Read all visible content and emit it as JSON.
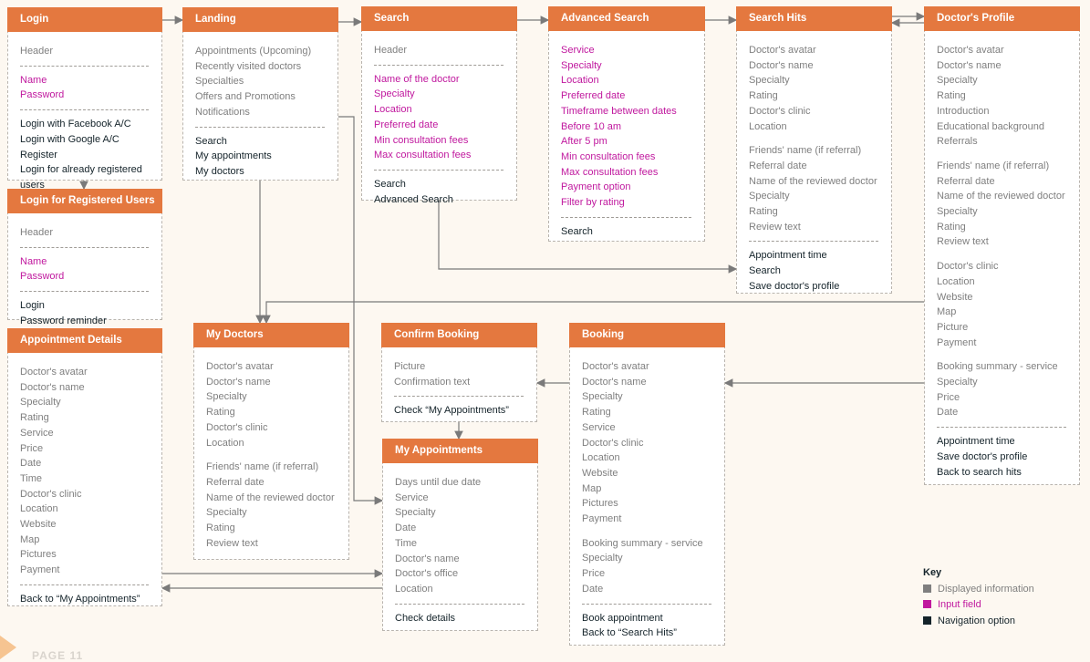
{
  "colors": {
    "header": "#e4783f",
    "display": "#7f7f7f",
    "input": "#c0189e",
    "nav": "#14232a",
    "background": "#fdf8f1"
  },
  "screens": [
    {
      "title": "Login",
      "sections": [
        {
          "kind": "display",
          "groups": [
            [
              "Header"
            ]
          ]
        },
        {
          "kind": "input",
          "groups": [
            [
              "Name",
              "Password"
            ]
          ]
        },
        {
          "kind": "nav",
          "groups": [
            [
              "Login with Facebook A/C",
              "Login with Google A/C",
              "Register",
              "Login for already registered users"
            ]
          ]
        }
      ]
    },
    {
      "title": "Landing",
      "sections": [
        {
          "kind": "display",
          "groups": [
            [
              "Appointments (Upcoming)",
              "Recently visited doctors",
              "Specialties",
              "Offers and Promotions",
              "Notifications"
            ]
          ]
        },
        {
          "kind": "nav",
          "groups": [
            [
              "Search",
              "My appointments",
              "My doctors"
            ]
          ]
        }
      ]
    },
    {
      "title": "Search",
      "sections": [
        {
          "kind": "display",
          "groups": [
            [
              "Header"
            ]
          ]
        },
        {
          "kind": "input",
          "groups": [
            [
              "Name of the doctor",
              "Specialty",
              "Location",
              "Preferred date",
              "Min consultation fees",
              "Max consultation fees"
            ]
          ]
        },
        {
          "kind": "nav",
          "groups": [
            [
              "Search",
              "Advanced Search"
            ]
          ]
        }
      ]
    },
    {
      "title": "Advanced Search",
      "sections": [
        {
          "kind": "input",
          "groups": [
            [
              "Service",
              "Specialty",
              "Location",
              "Preferred date",
              "Timeframe between dates",
              "Before 10 am",
              "After 5 pm",
              "Min consultation fees",
              "Max consultation fees",
              "Payment option",
              "Filter by rating"
            ]
          ]
        },
        {
          "kind": "nav",
          "groups": [
            [
              "Search"
            ]
          ]
        }
      ]
    },
    {
      "title": "Search Hits",
      "sections": [
        {
          "kind": "display",
          "groups": [
            [
              "Doctor's avatar",
              "Doctor's name",
              "Specialty",
              "Rating",
              "Doctor's clinic",
              "Location"
            ],
            [
              "Friends' name (if referral)",
              "Referral date",
              "Name of the reviewed doctor",
              "Specialty",
              "Rating",
              "Review text"
            ]
          ]
        },
        {
          "kind": "nav",
          "groups": [
            [
              "Appointment time",
              "Search",
              "Save doctor's profile"
            ]
          ]
        }
      ]
    },
    {
      "title": "Doctor's Profile",
      "sections": [
        {
          "kind": "display",
          "groups": [
            [
              "Doctor's avatar",
              "Doctor's name",
              "Specialty",
              "Rating",
              "Introduction",
              "Educational background",
              "Referrals"
            ],
            [
              "Friends' name (if referral)",
              "Referral date",
              "Name of the reviewed doctor",
              "Specialty",
              "Rating",
              "Review text"
            ],
            [
              "Doctor's clinic",
              "Location",
              "Website",
              "Map",
              "Picture",
              "Payment"
            ],
            [
              "Booking summary - service",
              "Specialty",
              "Price",
              "Date"
            ]
          ]
        },
        {
          "kind": "nav",
          "groups": [
            [
              "Appointment time",
              "Save doctor's profile",
              "Back to search hits"
            ]
          ]
        }
      ]
    },
    {
      "title": "Login for Registered Users",
      "sections": [
        {
          "kind": "display",
          "groups": [
            [
              "Header"
            ]
          ]
        },
        {
          "kind": "input",
          "groups": [
            [
              "Name",
              "Password"
            ]
          ]
        },
        {
          "kind": "nav",
          "groups": [
            [
              "Login",
              "Password reminder"
            ]
          ]
        }
      ]
    },
    {
      "title": "Appointment Details",
      "sections": [
        {
          "kind": "display",
          "groups": [
            [
              "Doctor's avatar",
              "Doctor's name",
              "Specialty",
              "Rating",
              "Service",
              "Price",
              "Date",
              "Time",
              "Doctor's clinic",
              "Location",
              "Website",
              "Map",
              "Pictures",
              "Payment"
            ]
          ]
        },
        {
          "kind": "nav",
          "groups": [
            [
              "Back to “My Appointments”"
            ]
          ]
        }
      ]
    },
    {
      "title": "My Doctors",
      "sections": [
        {
          "kind": "display",
          "groups": [
            [
              "Doctor's avatar",
              "Doctor's name",
              "Specialty",
              "Rating",
              "Doctor's clinic",
              "Location"
            ],
            [
              "Friends' name (if referral)",
              "Referral date",
              "Name of the reviewed doctor",
              "Specialty",
              "Rating",
              "Review text"
            ]
          ]
        }
      ]
    },
    {
      "title": "Confirm Booking",
      "sections": [
        {
          "kind": "display",
          "groups": [
            [
              "Picture",
              "Confirmation text"
            ]
          ]
        },
        {
          "kind": "nav",
          "groups": [
            [
              "Check “My Appointments”"
            ]
          ]
        }
      ]
    },
    {
      "title": "My Appointments",
      "sections": [
        {
          "kind": "display",
          "groups": [
            [
              "Days until due date",
              "Service",
              "Specialty",
              "Date",
              "Time",
              "Doctor's name",
              "Doctor's office",
              "Location"
            ]
          ]
        },
        {
          "kind": "nav",
          "groups": [
            [
              "Check details"
            ]
          ]
        }
      ]
    },
    {
      "title": "Booking",
      "sections": [
        {
          "kind": "display",
          "groups": [
            [
              "Doctor's avatar",
              "Doctor's name",
              "Specialty",
              "Rating",
              "Service",
              "Doctor's clinic",
              "Location",
              "Website",
              "Map",
              "Pictures",
              "Payment"
            ],
            [
              "Booking summary - service",
              "Specialty",
              "Price",
              "Date"
            ]
          ]
        },
        {
          "kind": "nav",
          "groups": [
            [
              "Book appointment",
              "Back to “Search Hits”"
            ]
          ]
        }
      ]
    }
  ],
  "key": {
    "title": "Key",
    "items": [
      {
        "label": "Displayed information",
        "color": "#7f7f7f"
      },
      {
        "label": "Input field",
        "color": "#c0189e"
      },
      {
        "label": "Navigation option",
        "color": "#14232a"
      }
    ]
  },
  "page_label": "PAGE 11"
}
